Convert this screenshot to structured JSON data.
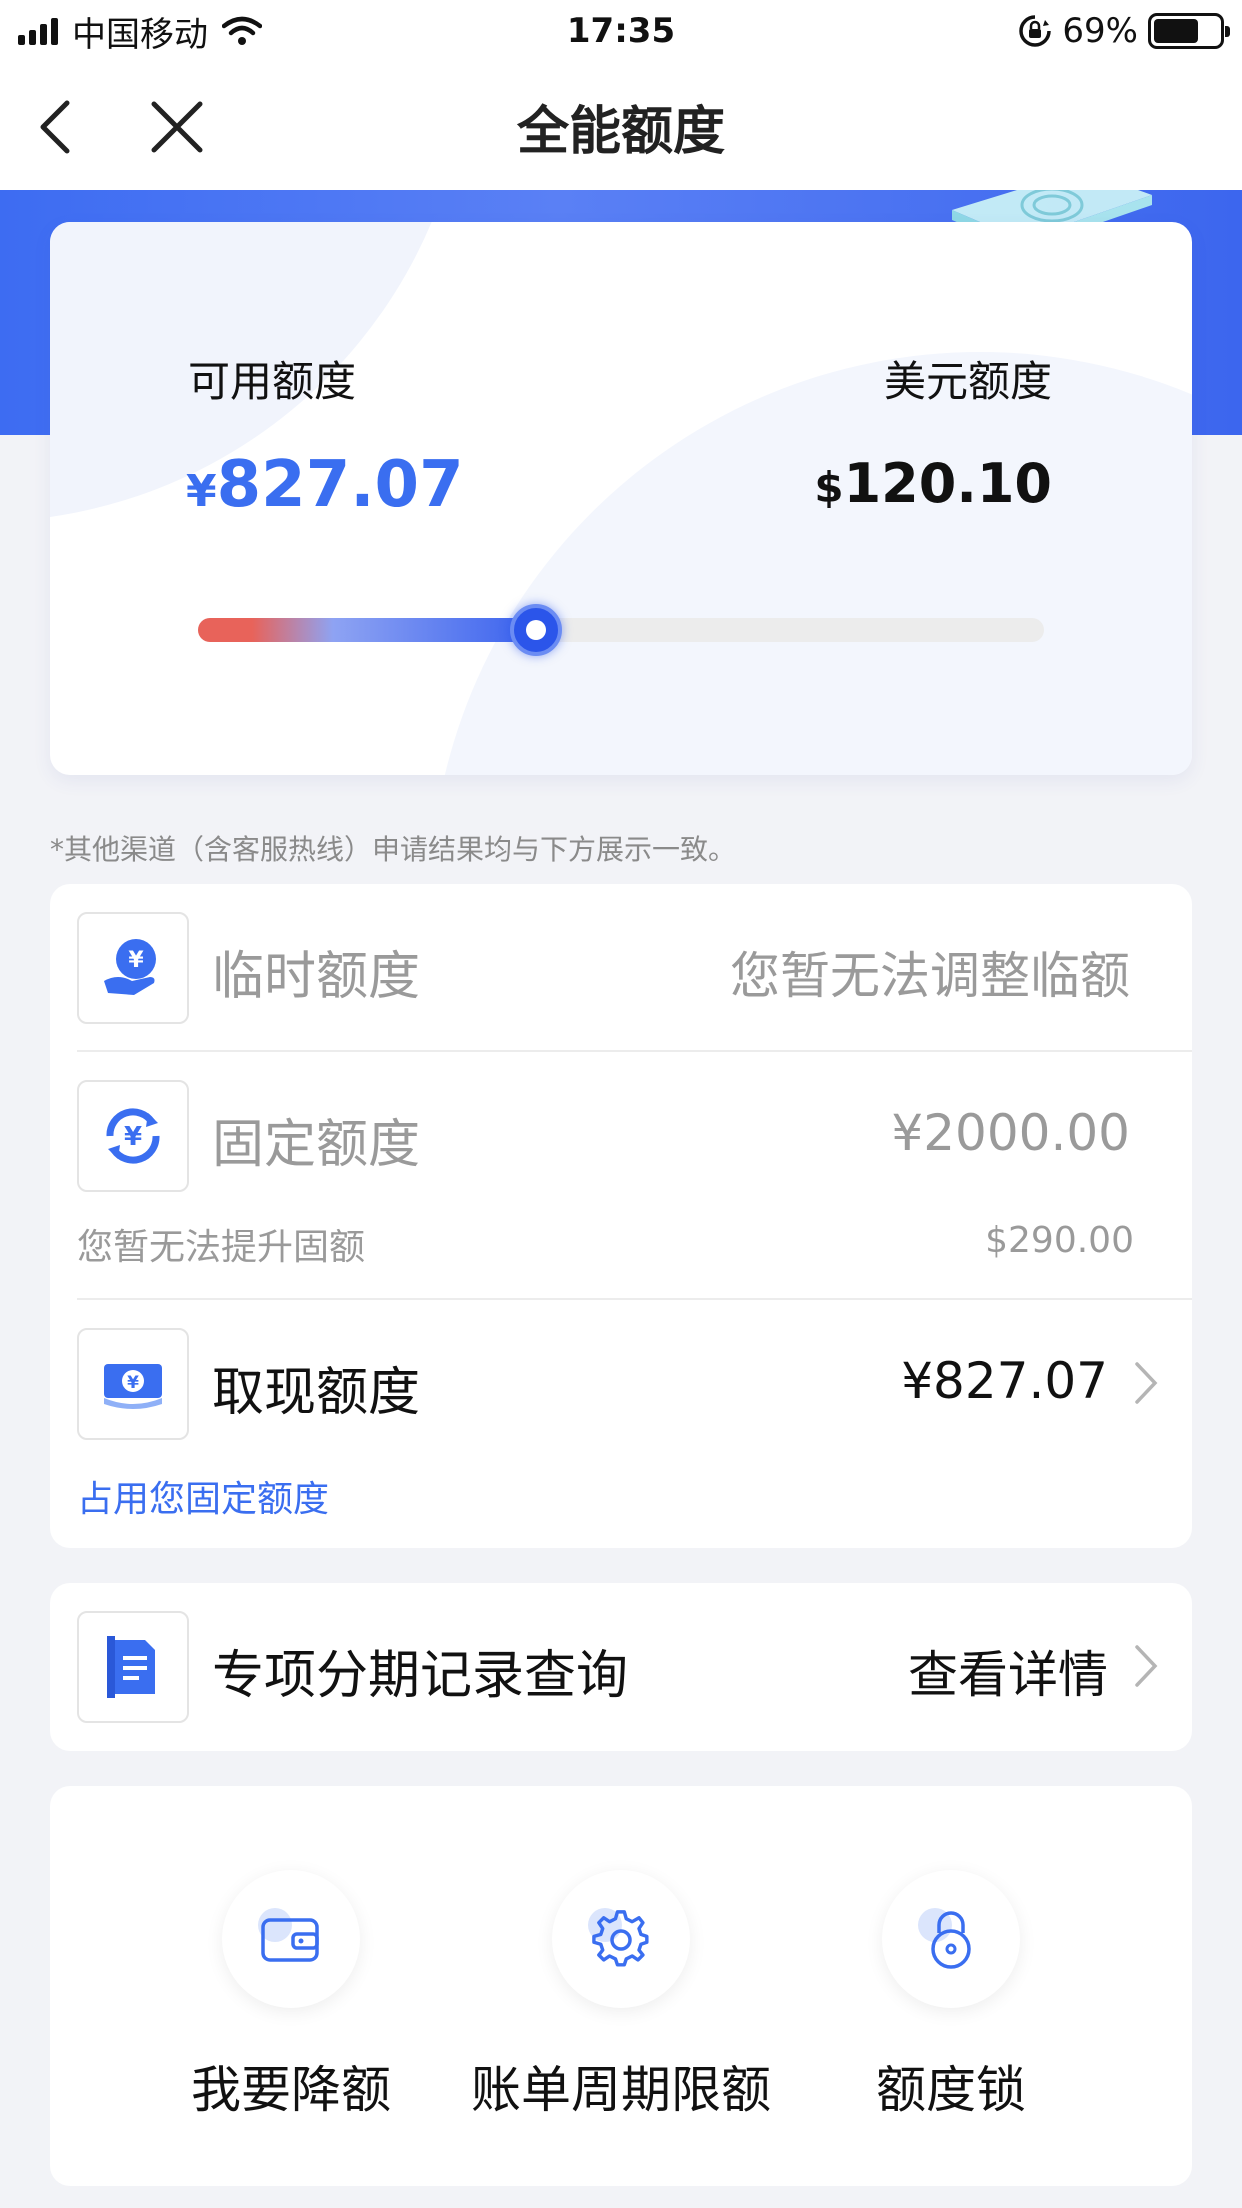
{
  "status_bar": {
    "carrier": "中国移动",
    "time": "17:35",
    "battery_pct": "69%",
    "battery_level": 0.69
  },
  "nav": {
    "title": "全能额度"
  },
  "summary": {
    "available_label": "可用额度",
    "available_currency": "¥",
    "available_amount": "827.07",
    "usd_label": "美元额度",
    "usd_currency": "$",
    "usd_amount": "120.10",
    "slider_fraction": 0.4
  },
  "note": "*其他渠道（含客服热线）申请结果均与下方展示一致。",
  "quota": {
    "temporary": {
      "icon": "hand-yuan-icon",
      "title": "临时额度",
      "value": "您暂无法调整临额"
    },
    "fixed": {
      "icon": "yuan-cycle-icon",
      "title": "固定额度",
      "value": "¥2000.00",
      "sub_left": "您暂无法提升固额",
      "sub_right": "$290.00"
    },
    "cash": {
      "icon": "cash-note-icon",
      "title": "取现额度",
      "value": "¥827.07",
      "sub_left": "占用您固定额度"
    }
  },
  "installment": {
    "icon": "document-icon",
    "title": "专项分期记录查询",
    "link": "查看详情"
  },
  "actions": [
    {
      "icon": "wallet-icon",
      "label": "我要降额"
    },
    {
      "icon": "gear-icon",
      "label": "账单周期限额"
    },
    {
      "icon": "lock-icon",
      "label": "额度锁"
    }
  ],
  "colors": {
    "accent": "#3a6ef0",
    "banner": "#4470f2",
    "muted_text": "#9a9a9a"
  }
}
